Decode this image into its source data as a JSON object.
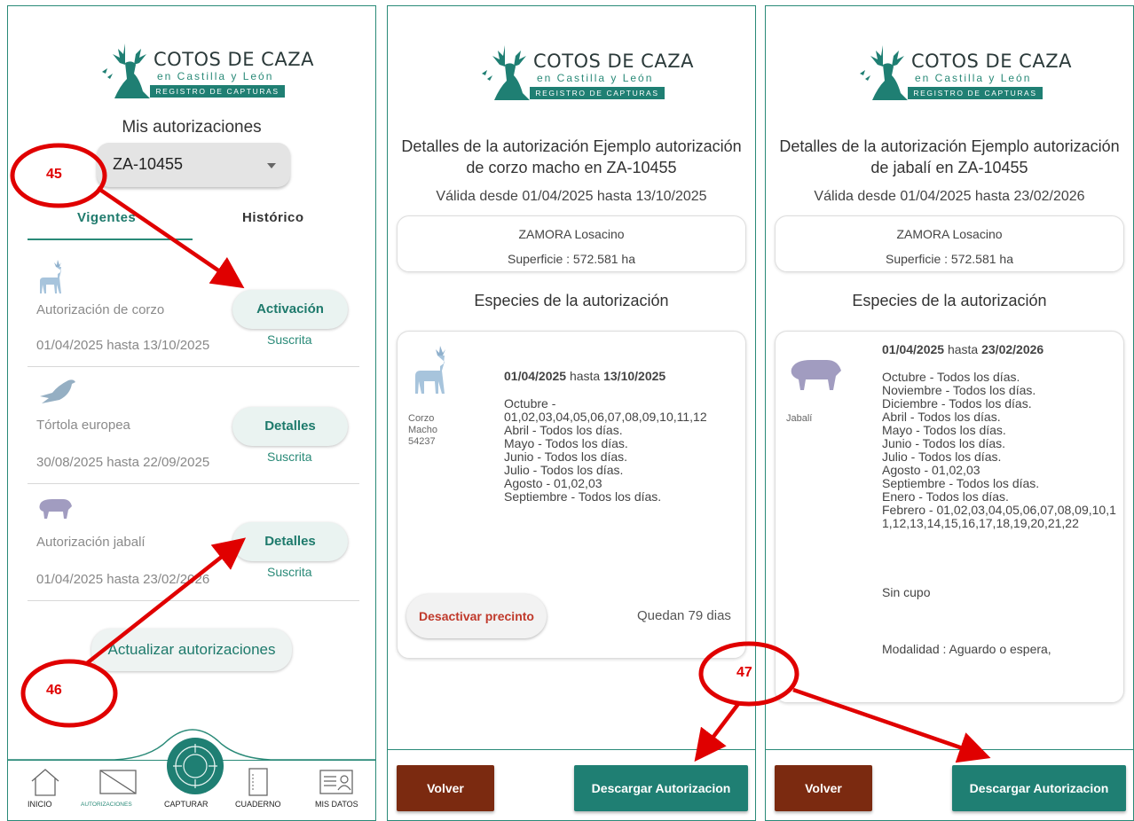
{
  "brand": {
    "line1": "COTOS DE CAZA",
    "line2": "en Castilla y León",
    "line3": "REGISTRO DE CAPTURAS",
    "color": "#1f7f73"
  },
  "screen1": {
    "title": "Mis autorizaciones",
    "dropdown_value": "ZA-10455",
    "tabs": [
      {
        "label": "Vigentes"
      },
      {
        "label": "Histórico"
      }
    ],
    "items": [
      {
        "icon": "roe-deer-icon",
        "name": "Autorización de corzo",
        "dates": "01/04/2025 hasta 13/10/2025",
        "button": "Activación",
        "status": "Suscrita"
      },
      {
        "icon": "turtle-dove-icon",
        "name": "Tórtola europea",
        "dates": "30/08/2025 hasta 22/09/2025",
        "button": "Detalles",
        "status": "Suscrita"
      },
      {
        "icon": "wild-boar-icon",
        "name": "Autorización jabalí",
        "dates": "01/04/2025 hasta 23/02/2026",
        "button": "Detalles",
        "status": "Suscrita"
      }
    ],
    "refresh_button": "Actualizar autorizaciones",
    "nav": [
      {
        "label": "INICIO",
        "icon": "home-icon"
      },
      {
        "label": "AUTORIZACIONES",
        "icon": "authorization-icon"
      },
      {
        "label": "CAPTURAR",
        "icon": "target-icon"
      },
      {
        "label": "CUADERNO",
        "icon": "notebook-icon"
      },
      {
        "label": "MIS DATOS",
        "icon": "id-card-icon"
      }
    ]
  },
  "screen2": {
    "title_line1": "Detalles de la  autorización  Ejemplo autorización",
    "title_line2": "de corzo macho en ZA-10455",
    "validity": "Válida desde  01/04/2025 hasta 13/10/2025",
    "area_name": "ZAMORA Losacino",
    "surface": "Superficie : 572.581 ha",
    "species_heading": "Especies de la autorización",
    "species_label_1": "Corzo",
    "species_label_2": "Macho",
    "species_label_3": "54237",
    "date_from": "01/04/2025",
    "date_sep": " hasta ",
    "date_to": "13/10/2025",
    "periods": [
      "Octubre -",
      "01,02,03,04,05,06,07,08,09,10,11,12",
      "Abril - Todos los días.",
      "Mayo - Todos los días.",
      "Junio - Todos los días.",
      "Julio - Todos los días.",
      "Agosto - 01,02,03",
      "Septiembre - Todos los días."
    ],
    "deactivate_button": "Desactivar precinto",
    "days_left": "Quedan 79 dias",
    "back_button": "Volver",
    "download_button": "Descargar Autorizacion"
  },
  "screen3": {
    "title_line1": "Detalles de la  autorización  Ejemplo autorización",
    "title_line2": "de jabalí en ZA-10455",
    "validity": "Válida desde  01/04/2025 hasta 23/02/2026",
    "area_name": "ZAMORA Losacino",
    "surface": "Superficie : 572.581 ha",
    "species_heading": "Especies de la autorización",
    "species_label": "Jabalí",
    "date_from": "01/04/2025",
    "date_sep": " hasta ",
    "date_to": "23/02/2026",
    "periods": [
      "Octubre - Todos los días.",
      "Noviembre - Todos los días.",
      "Diciembre - Todos los días.",
      "Abril - Todos los días.",
      "Mayo - Todos los días.",
      "Junio - Todos los días.",
      "Julio - Todos los días.",
      "Agosto - 01,02,03",
      "Septiembre - Todos los días.",
      "Enero - Todos los días.",
      "Febrero - 01,02,03,04,05,06,07,08,09,10,1",
      "1,12,13,14,15,16,17,18,19,20,21,22"
    ],
    "quota": "Sin cupo",
    "modality": "Modalidad : Aguardo o espera,",
    "back_button": "Volver",
    "download_button": "Descargar Autorizacion"
  },
  "annotations": {
    "marker_45": "45",
    "marker_46": "46",
    "marker_47": "47",
    "color": "#e00000"
  }
}
